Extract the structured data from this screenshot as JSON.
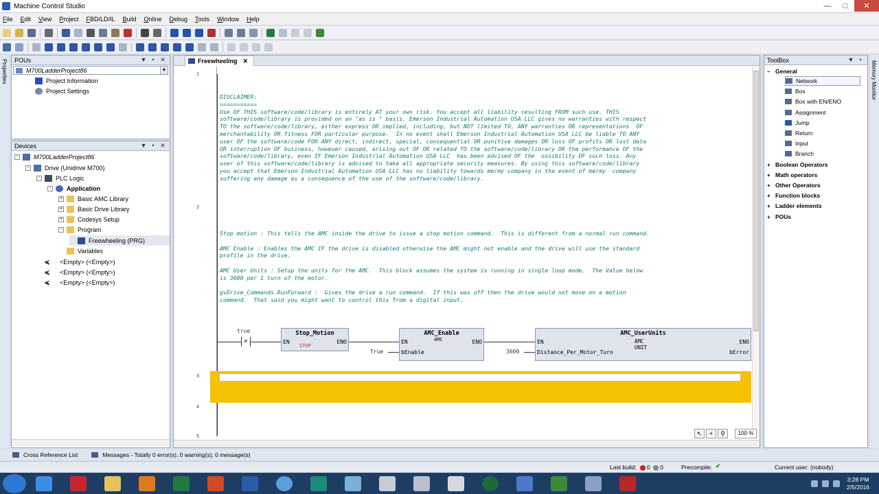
{
  "window": {
    "title": "Machine Control Studio"
  },
  "menu": [
    "File",
    "Edit",
    "View",
    "Project",
    "FBD/LD/IL",
    "Build",
    "Online",
    "Debug",
    "Tools",
    "Window",
    "Help"
  ],
  "pous": {
    "header": "POUs",
    "project": "M700LadderProject86",
    "items": [
      "Project Information",
      "Project Settings"
    ]
  },
  "devices": {
    "header": "Devices",
    "project": "M700LadderProject86",
    "drive": "Drive (Unidrive M700)",
    "plc": "PLC Logic",
    "application": "Application",
    "folders": [
      "Basic AMC Library",
      "Basic Drive Library",
      "Codesys Setup",
      "Program"
    ],
    "program": "Freewheeling (PRG)",
    "variables": "Variables",
    "empty": [
      "<Empty> (<Empty>)",
      "<Empty> (<Empty>)",
      "<Empty> (<Empty>)"
    ]
  },
  "editor": {
    "tab": "Freewheeling",
    "line_numbers": [
      "1",
      "2",
      "3",
      "4",
      "5"
    ],
    "disclaimer": "DISCLAIMER:\n===========\nUse OF THIS software/code/library is entirely AT your own risk. You accept all liability resulting FROM such use. THIS\nsoftware/code/library is provided on an \"as is \" basis. Emerson Industrial Automation USA LLC gives no warranties with respect\nTO the software/code/library, either express OR implied, including, but NOT limited TO, ANY warranties OR representations  OF\nmerchantability OR fitness FOR particular purpose.  In no event shall Emerson Industrial Automation USA LLC be liable TO ANY\nuser OF the software/code FOR ANY direct, indirect, special, consequential OR punitive damages OR loss OF profits OR lost data\nOR interruption OF business, however caused, arising out OF OR related TO the software/code/library OR the performance OF the\nsoftware/code/library, even IF Emerson Industrial Automation USA LLC  has been advised OF the  ossibility OF such loss. Any\nuser of this software/code/library is advised to take all appropriate security measures. By using this software/code/library\nyou accept that Emerson Industrial Automation USA LLC has no liability towards me/my company in the event of me/my  company\nsuffering any damage as a consequence of the use of the software/code/library.",
    "comment2": "Stop motion : This tells the AMC inside the drive to issue a stop motion command.  This is different from a normal run command.\n\nAMC Enable : Enables the AMC IF the drive is disabled otherwise the AMC might not enable and the drive will use the standard\nprofile in the drive.\n\nAMC User Units : Setup the units for the AMC.  This block assumes the system is running in single loop mode.  The Value below\nis 3600 per 1 turn of the motor.\n\ngvDrive_Commands.RunForward :  Gives the drive a run command.  If this was off then the drive would not move on a motion\ncommand.  That said you might want to control this from a digital input.",
    "contact_label": "true",
    "contact_symbol": "P",
    "block1": {
      "name": "Stop_Motion",
      "en": "EN",
      "eno": "ENO",
      "icon_text": "STOP"
    },
    "block2": {
      "name": "AMC_Enable",
      "en": "EN",
      "eno": "ENO",
      "input": "bEnable",
      "const": "True",
      "icon_text": "AMC"
    },
    "block3": {
      "name": "AMC_UserUnits",
      "en": "EN",
      "eno": "ENO",
      "input": "Distance_Per_Motor_Turn",
      "output": "bError",
      "const": "3600",
      "icon_text": "AMC\nUNIT"
    },
    "zoom": "100 %"
  },
  "toolbox": {
    "header": "ToolBox",
    "general": "General",
    "general_items": [
      "Network",
      "Box",
      "Box with EN/ENO",
      "Assignment",
      "Jump",
      "Return",
      "Input",
      "Branch"
    ],
    "categories": [
      "Boolean Operators",
      "Math operators",
      "Other Operators",
      "Function blocks",
      "Ladder elements",
      "POUs"
    ]
  },
  "side_tabs": {
    "left": "Properties",
    "right": "Memory Monitor"
  },
  "messages": {
    "cross_ref": "Cross Reference List",
    "messages": "Messages - Totally 0 error(s), 0 warning(s), 0 message(s)"
  },
  "status": {
    "last_build": "Last build:",
    "errors": "0",
    "warnings": "0",
    "precompile": "Precompile:",
    "current_user": "Current user: (nobody)"
  },
  "clock": {
    "time": "3:28 PM",
    "date": "2/5/2016"
  },
  "colors": {
    "accent": "#f5c200",
    "comment": "#0a7a72",
    "taskbar": "#1e3d63"
  }
}
